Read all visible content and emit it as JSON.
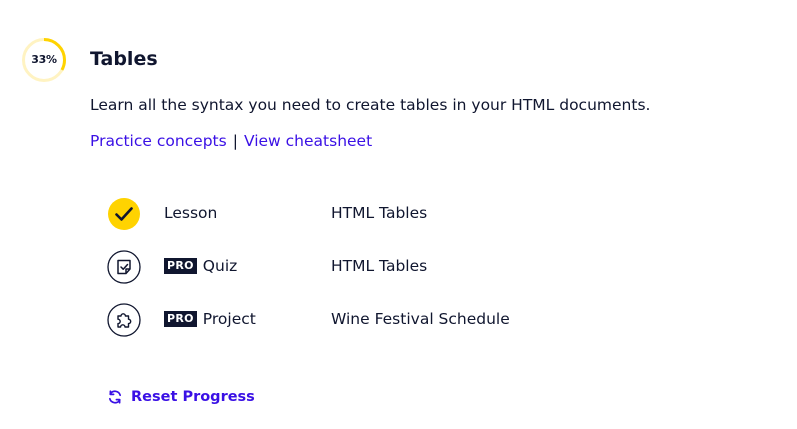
{
  "module": {
    "progress": {
      "text": "33%",
      "fraction": 0.33
    },
    "title": "Tables",
    "description": "Learn all the syntax you need to create tables in your HTML documents.",
    "links": {
      "practice": "Practice concepts",
      "separator": "|",
      "cheatsheet": "View cheatsheet"
    },
    "items": [
      {
        "type": "Lesson",
        "pro": false,
        "name": "HTML Tables",
        "icon": "check-icon",
        "completed": true
      },
      {
        "type": "Quiz",
        "pro": true,
        "pro_label": "PRO",
        "name": "HTML Tables",
        "icon": "quiz-icon",
        "completed": false
      },
      {
        "type": "Project",
        "pro": true,
        "pro_label": "PRO",
        "name": "Wine Festival Schedule",
        "icon": "puzzle-icon",
        "completed": false
      }
    ],
    "reset_label": "Reset Progress"
  },
  "colors": {
    "accent": "#3a10e5",
    "progress": "#ffd300",
    "progress_track": "#fff3c2",
    "text": "#10162f"
  }
}
